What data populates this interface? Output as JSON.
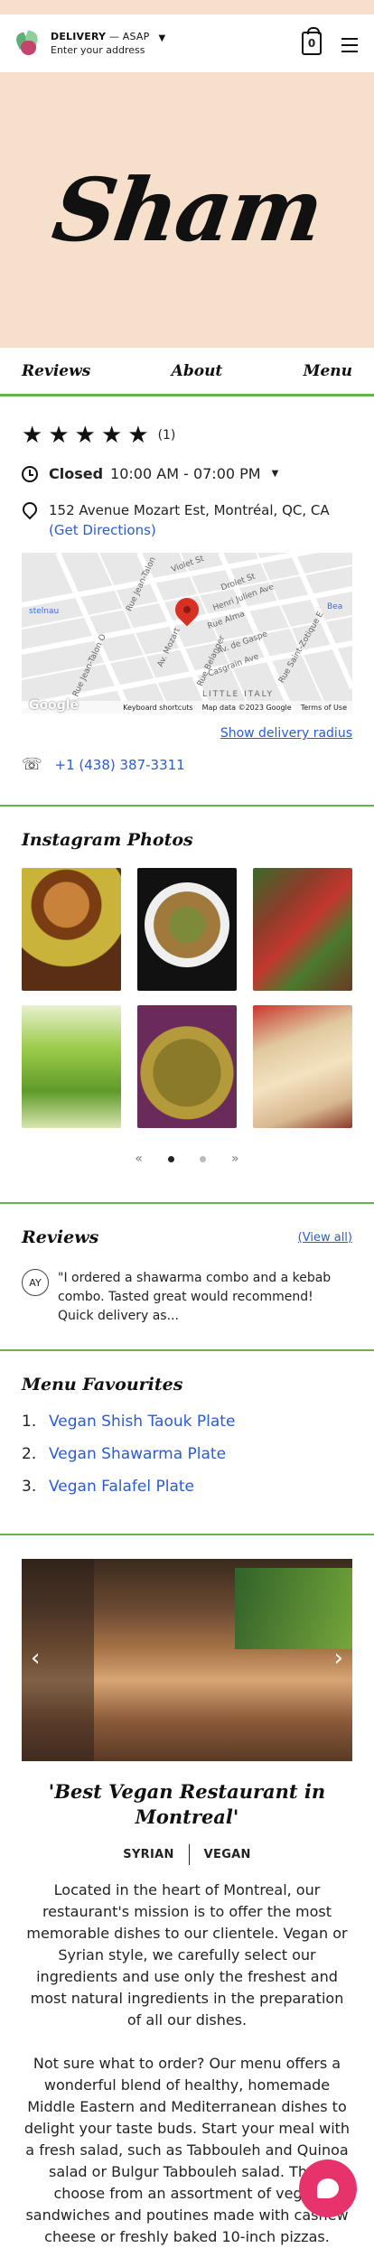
{
  "header": {
    "delivery_label": "DELIVERY",
    "delivery_time": " — ASAP",
    "address_placeholder": "Enter your address",
    "cart_count": "0"
  },
  "hero": {
    "logo_text": "Sham"
  },
  "nav": {
    "tabs": [
      {
        "label": "Reviews"
      },
      {
        "label": "About"
      },
      {
        "label": "Menu"
      }
    ]
  },
  "info": {
    "rating_stars": 5,
    "rating_count": "(1)",
    "status": "Closed",
    "hours": "10:00 AM - 07:00 PM",
    "address": "152 Avenue Mozart Est, Montréal, QC, CA",
    "directions": "(Get Directions)",
    "delivery_radius": "Show delivery radius",
    "phone": "+1 (438) 387-3311",
    "map": {
      "labels": [
        "Rue Jean-Talon",
        "Av. Mozart",
        "Rue Jean-Talon O",
        "Rue Alma",
        "Henri Julien Ave",
        "Drolet St",
        "Violet St",
        "Av. de Gaspe",
        "Rue Belanger",
        "Casgrain Ave",
        "Rue Saint-Zotique E",
        "stelnau",
        "Bea",
        "LITTLE ITALY"
      ],
      "google": "Google",
      "shortcuts": "Keyboard shortcuts",
      "map_data": "Map data ©2023 Google",
      "terms": "Terms of Use"
    }
  },
  "instagram": {
    "title": "Instagram Photos",
    "photos": [
      {
        "name": "tagine-photo"
      },
      {
        "name": "plate-photo"
      },
      {
        "name": "kebab-photo"
      },
      {
        "name": "lemonade-photo"
      },
      {
        "name": "falafel-tray-photo"
      },
      {
        "name": "wrap-photo"
      }
    ],
    "prev": "«",
    "next": "»"
  },
  "reviews": {
    "title": "Reviews",
    "view_all": "(View all)",
    "items": [
      {
        "initials": "AY",
        "text": "\"I ordered a shawarma combo and a kebab combo. Tasted great would recommend! Quick delivery as..."
      }
    ]
  },
  "favourites": {
    "title": "Menu Favourites",
    "items": [
      {
        "num": "1.",
        "label": "Vegan Shish Taouk Plate"
      },
      {
        "num": "2.",
        "label": "Vegan Shawarma Plate"
      },
      {
        "num": "3.",
        "label": "Vegan Falafel Plate"
      }
    ]
  },
  "about": {
    "tagline": "'Best Vegan Restaurant in Montreal'",
    "cuisines": [
      "SYRIAN",
      "VEGAN"
    ],
    "paragraphs": [
      "Located in the heart of Montreal, our restaurant's mission is to offer the most memorable dishes to our clientele. Vegan or Syrian style, we carefully select our ingredients and use only the freshest and most natural ingredients in the preparation of all our dishes.",
      "Not sure what to order? Our menu offers a wonderful blend of healthy, homemade Middle Eastern and Mediterranean dishes to delight your taste buds. Start your meal with a fresh salad, such as Tabbouleh and Quinoa salad or Bulgur Tabbouleh salad. Then choose from an assortment of vegan sandwiches and poutines made with cashew cheese or freshly baked 10-inch pizzas."
    ]
  },
  "colors": {
    "accent": "#6ab04c",
    "link": "#2a5bd7",
    "hero_bg": "#f6dfcb",
    "chat": "#e6336b"
  }
}
